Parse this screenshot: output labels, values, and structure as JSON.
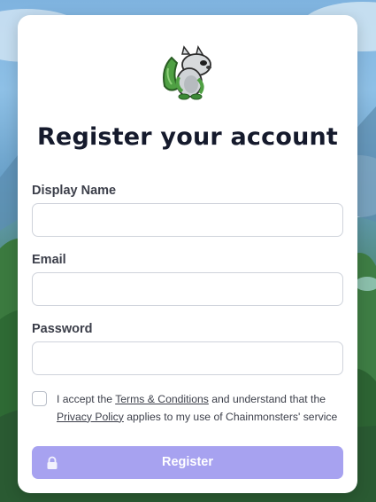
{
  "form": {
    "title": "Register your account",
    "fields": [
      {
        "label": "Display Name",
        "value": "",
        "placeholder": ""
      },
      {
        "label": "Email",
        "value": "",
        "placeholder": ""
      },
      {
        "label": "Password",
        "value": "",
        "placeholder": ""
      }
    ],
    "terms": {
      "text1": "I accept the ",
      "terms_link": "Terms & Conditions",
      "text2": " and understand that the ",
      "privacy_link": "Privacy Policy",
      "text3": " applies to my use of Chainmonsters' service",
      "checked": false
    },
    "register_label": "Register"
  },
  "icons": {
    "logo": "chainmonsters-creature-icon",
    "lock": "lock-icon"
  },
  "colors": {
    "button": "#a7a2f0",
    "title": "#151a2c",
    "card": "#ffffff"
  }
}
